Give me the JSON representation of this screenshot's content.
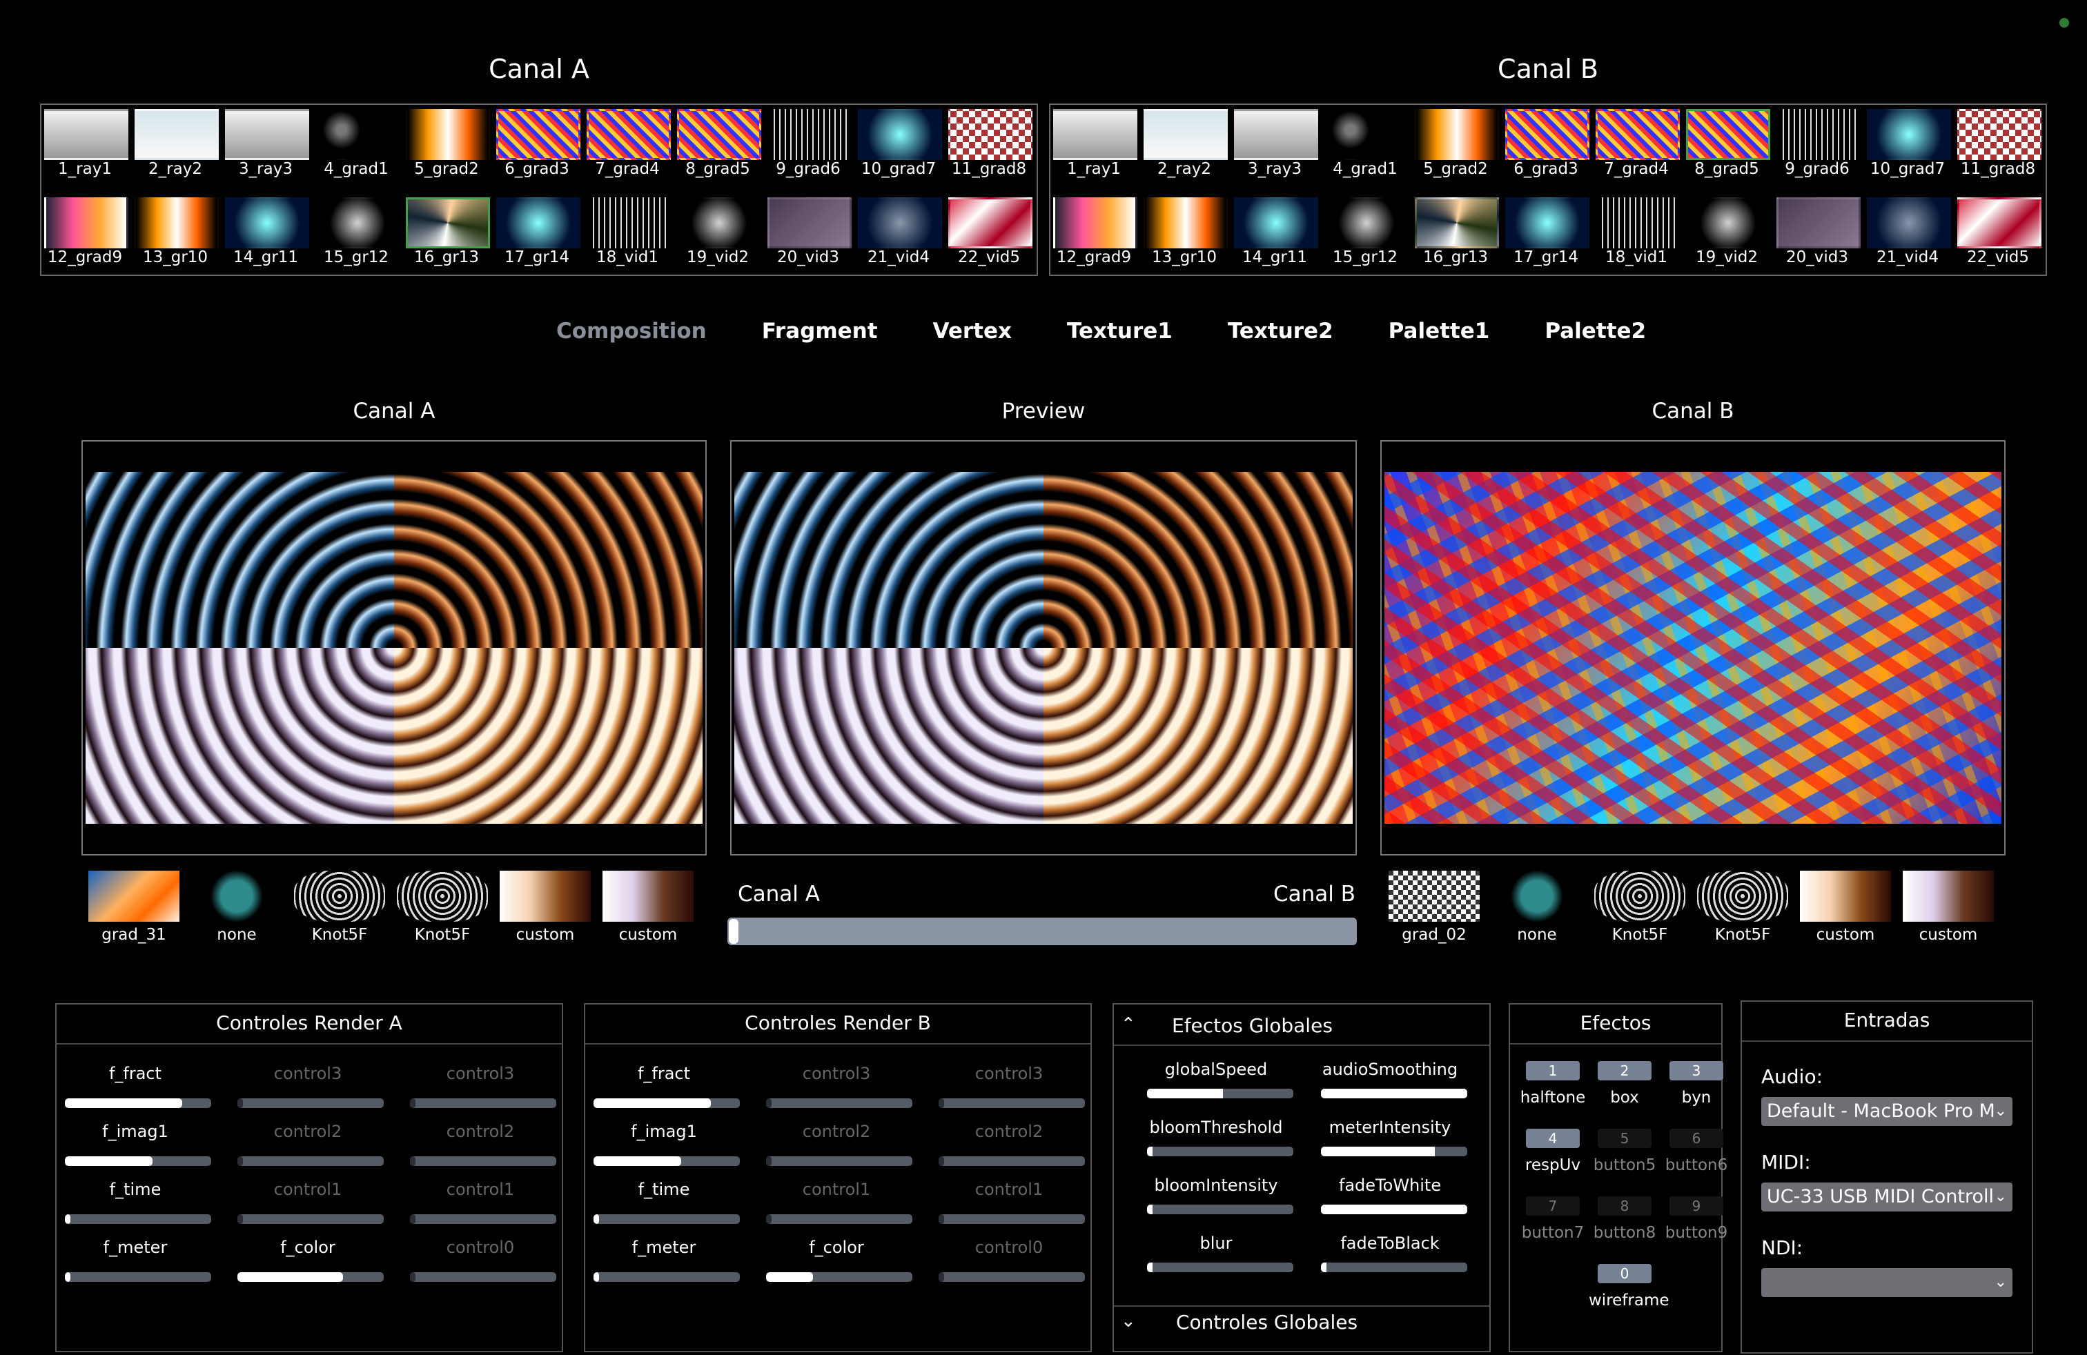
{
  "channel_bank_a": {
    "title": "Canal A",
    "items": [
      {
        "label": "1_ray1",
        "style": "t-bird"
      },
      {
        "label": "2_ray2",
        "style": "t-bird2"
      },
      {
        "label": "3_ray3",
        "style": "t-bird"
      },
      {
        "label": "4_grad1",
        "style": "t-dark"
      },
      {
        "label": "5_grad2",
        "style": "t-fire"
      },
      {
        "label": "6_grad3",
        "style": "t-psy"
      },
      {
        "label": "7_grad4",
        "style": "t-psy"
      },
      {
        "label": "8_grad5",
        "style": "t-psy"
      },
      {
        "label": "9_grad6",
        "style": "t-lines"
      },
      {
        "label": "10_grad7",
        "style": "t-blue"
      },
      {
        "label": "11_grad8",
        "style": "t-checker"
      },
      {
        "label": "12_grad9",
        "style": "t-orange"
      },
      {
        "label": "13_gr10",
        "style": "t-fire"
      },
      {
        "label": "14_gr11",
        "style": "t-blue"
      },
      {
        "label": "15_gr12",
        "style": "t-star"
      },
      {
        "label": "16_gr13",
        "style": "t-swirl2",
        "selected": true
      },
      {
        "label": "17_gr14",
        "style": "t-blue"
      },
      {
        "label": "18_vid1",
        "style": "t-lines"
      },
      {
        "label": "19_vid2",
        "style": "t-star"
      },
      {
        "label": "20_vid3",
        "style": "t-purple"
      },
      {
        "label": "21_vid4",
        "style": "t-navy"
      },
      {
        "label": "22_vid5",
        "style": "t-red"
      }
    ]
  },
  "channel_bank_b": {
    "title": "Canal B",
    "items": [
      {
        "label": "1_ray1",
        "style": "t-bird"
      },
      {
        "label": "2_ray2",
        "style": "t-bird2"
      },
      {
        "label": "3_ray3",
        "style": "t-bird"
      },
      {
        "label": "4_grad1",
        "style": "t-dark"
      },
      {
        "label": "5_grad2",
        "style": "t-fire"
      },
      {
        "label": "6_grad3",
        "style": "t-psy"
      },
      {
        "label": "7_grad4",
        "style": "t-psy"
      },
      {
        "label": "8_grad5",
        "style": "t-psy",
        "selected": true
      },
      {
        "label": "9_grad6",
        "style": "t-lines"
      },
      {
        "label": "10_grad7",
        "style": "t-blue"
      },
      {
        "label": "11_grad8",
        "style": "t-checker"
      },
      {
        "label": "12_grad9",
        "style": "t-orange"
      },
      {
        "label": "13_gr10",
        "style": "t-fire"
      },
      {
        "label": "14_gr11",
        "style": "t-blue"
      },
      {
        "label": "15_gr12",
        "style": "t-star"
      },
      {
        "label": "16_gr13",
        "style": "t-swirl2"
      },
      {
        "label": "17_gr14",
        "style": "t-blue"
      },
      {
        "label": "18_vid1",
        "style": "t-lines"
      },
      {
        "label": "19_vid2",
        "style": "t-star"
      },
      {
        "label": "20_vid3",
        "style": "t-purple"
      },
      {
        "label": "21_vid4",
        "style": "t-navy"
      },
      {
        "label": "22_vid5",
        "style": "t-red"
      }
    ]
  },
  "tabs": [
    "Composition",
    "Fragment",
    "Vertex",
    "Texture1",
    "Texture2",
    "Palette1",
    "Palette2"
  ],
  "active_tab": "Composition",
  "previews": {
    "canal_a": "Canal A",
    "preview": "Preview",
    "canal_b": "Canal B"
  },
  "textures_a": [
    {
      "label": "grad_31",
      "style": "g-grad31"
    },
    {
      "label": "none",
      "style": "g-none"
    },
    {
      "label": "Knot5F",
      "style": "g-knot"
    },
    {
      "label": "Knot5F",
      "style": "g-knot"
    },
    {
      "label": "custom",
      "style": "g-custom"
    },
    {
      "label": "custom",
      "style": "g-custom2"
    }
  ],
  "textures_b": [
    {
      "label": "grad_02",
      "style": "g-grad02"
    },
    {
      "label": "none",
      "style": "g-none"
    },
    {
      "label": "Knot5F",
      "style": "g-knot"
    },
    {
      "label": "Knot5F",
      "style": "g-knot"
    },
    {
      "label": "custom",
      "style": "g-custom"
    },
    {
      "label": "custom",
      "style": "g-custom2"
    }
  ],
  "crossfader": {
    "left_label": "Canal A",
    "right_label": "Canal B",
    "value": 0.0
  },
  "render_a": {
    "title": "Controles Render A",
    "controls": [
      {
        "name": "f_fract",
        "value": 0.8,
        "active": true
      },
      {
        "name": "control3",
        "value": 0.0,
        "active": false
      },
      {
        "name": "control3",
        "value": 0.0,
        "active": false
      },
      {
        "name": "f_imag1",
        "value": 0.6,
        "active": true
      },
      {
        "name": "control2",
        "value": 0.0,
        "active": false
      },
      {
        "name": "control2",
        "value": 0.0,
        "active": false
      },
      {
        "name": "f_time",
        "value": 0.03,
        "active": true
      },
      {
        "name": "control1",
        "value": 0.0,
        "active": false
      },
      {
        "name": "control1",
        "value": 0.0,
        "active": false
      },
      {
        "name": "f_meter",
        "value": 0.0,
        "active": true
      },
      {
        "name": "f_color",
        "value": 0.72,
        "active": true
      },
      {
        "name": "control0",
        "value": 0.0,
        "active": false
      }
    ]
  },
  "render_b": {
    "title": "Controles Render B",
    "controls": [
      {
        "name": "f_fract",
        "value": 0.8,
        "active": true
      },
      {
        "name": "control3",
        "value": 0.0,
        "active": false
      },
      {
        "name": "control3",
        "value": 0.0,
        "active": false
      },
      {
        "name": "f_imag1",
        "value": 0.6,
        "active": true
      },
      {
        "name": "control2",
        "value": 0.0,
        "active": false
      },
      {
        "name": "control2",
        "value": 0.0,
        "active": false
      },
      {
        "name": "f_time",
        "value": 0.03,
        "active": true
      },
      {
        "name": "control1",
        "value": 0.0,
        "active": false
      },
      {
        "name": "control1",
        "value": 0.0,
        "active": false
      },
      {
        "name": "f_meter",
        "value": 0.0,
        "active": true
      },
      {
        "name": "f_color",
        "value": 0.32,
        "active": true
      },
      {
        "name": "control0",
        "value": 0.0,
        "active": false
      }
    ]
  },
  "efectos_globales": {
    "title": "Efectos Globales",
    "controls": [
      {
        "name": "globalSpeed",
        "value": 0.52
      },
      {
        "name": "audioSmoothing",
        "value": 1.0
      },
      {
        "name": "bloomThreshold",
        "value": 0.0
      },
      {
        "name": "meterIntensity",
        "value": 0.78
      },
      {
        "name": "bloomIntensity",
        "value": 0.0
      },
      {
        "name": "fadeToWhite",
        "value": 1.0
      },
      {
        "name": "blur",
        "value": 0.0
      },
      {
        "name": "fadeToBlack",
        "value": 0.02
      }
    ],
    "footer": "Controles Globales"
  },
  "efectos": {
    "title": "Efectos",
    "buttons": [
      {
        "num": "1",
        "label": "halftone",
        "on": true
      },
      {
        "num": "2",
        "label": "box",
        "on": true
      },
      {
        "num": "3",
        "label": "byn",
        "on": true
      },
      {
        "num": "4",
        "label": "respUv",
        "on": true
      },
      {
        "num": "5",
        "label": "button5",
        "on": false
      },
      {
        "num": "6",
        "label": "button6",
        "on": false
      },
      {
        "num": "7",
        "label": "button7",
        "on": false
      },
      {
        "num": "8",
        "label": "button8",
        "on": false
      },
      {
        "num": "9",
        "label": "button9",
        "on": false
      },
      {
        "num": "0",
        "label": "wireframe",
        "on": true
      }
    ]
  },
  "entradas": {
    "title": "Entradas",
    "audio_label": "Audio:",
    "audio_value": "Default - MacBook Pro M",
    "midi_label": "MIDI:",
    "midi_value": "UC-33 USB MIDI Controll",
    "ndi_label": "NDI:",
    "ndi_value": ""
  }
}
